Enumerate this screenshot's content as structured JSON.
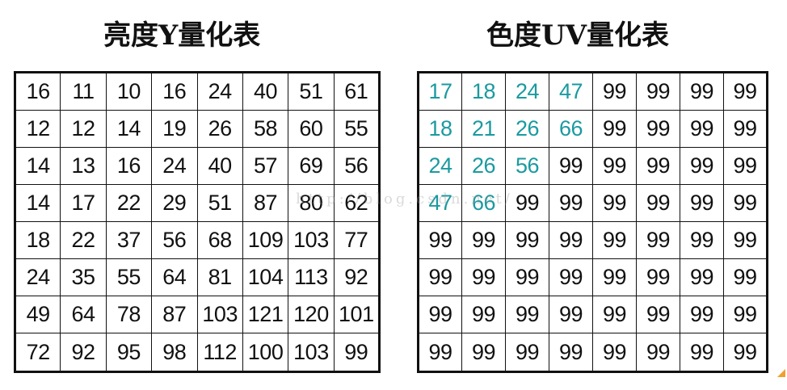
{
  "luma_title": "亮度Y量化表",
  "chroma_title": "色度UV量化表",
  "watermark": "http://blog.csdn.net/",
  "highlight_color": "#1a9aa0",
  "luma_table": [
    [
      "16",
      "11",
      "10",
      "16",
      "24",
      "40",
      "51",
      "61"
    ],
    [
      "12",
      "12",
      "14",
      "19",
      "26",
      "58",
      "60",
      "55"
    ],
    [
      "14",
      "13",
      "16",
      "24",
      "40",
      "57",
      "69",
      "56"
    ],
    [
      "14",
      "17",
      "22",
      "29",
      "51",
      "87",
      "80",
      "62"
    ],
    [
      "18",
      "22",
      "37",
      "56",
      "68",
      "109",
      "103",
      "77"
    ],
    [
      "24",
      "35",
      "55",
      "64",
      "81",
      "104",
      "113",
      "92"
    ],
    [
      "49",
      "64",
      "78",
      "87",
      "103",
      "121",
      "120",
      "101"
    ],
    [
      "72",
      "92",
      "95",
      "98",
      "112",
      "100",
      "103",
      "99"
    ]
  ],
  "chroma_table": [
    [
      "17",
      "18",
      "24",
      "47",
      "99",
      "99",
      "99",
      "99"
    ],
    [
      "18",
      "21",
      "26",
      "66",
      "99",
      "99",
      "99",
      "99"
    ],
    [
      "24",
      "26",
      "56",
      "99",
      "99",
      "99",
      "99",
      "99"
    ],
    [
      "47",
      "66",
      "99",
      "99",
      "99",
      "99",
      "99",
      "99"
    ],
    [
      "99",
      "99",
      "99",
      "99",
      "99",
      "99",
      "99",
      "99"
    ],
    [
      "99",
      "99",
      "99",
      "99",
      "99",
      "99",
      "99",
      "99"
    ],
    [
      "99",
      "99",
      "99",
      "99",
      "99",
      "99",
      "99",
      "99"
    ],
    [
      "99",
      "99",
      "99",
      "99",
      "99",
      "99",
      "99",
      "99"
    ]
  ],
  "chroma_highlighted_cells": [
    [
      0,
      0
    ],
    [
      0,
      1
    ],
    [
      0,
      2
    ],
    [
      0,
      3
    ],
    [
      1,
      0
    ],
    [
      1,
      1
    ],
    [
      1,
      2
    ],
    [
      1,
      3
    ],
    [
      2,
      0
    ],
    [
      2,
      1
    ],
    [
      2,
      2
    ],
    [
      3,
      0
    ],
    [
      3,
      1
    ]
  ]
}
